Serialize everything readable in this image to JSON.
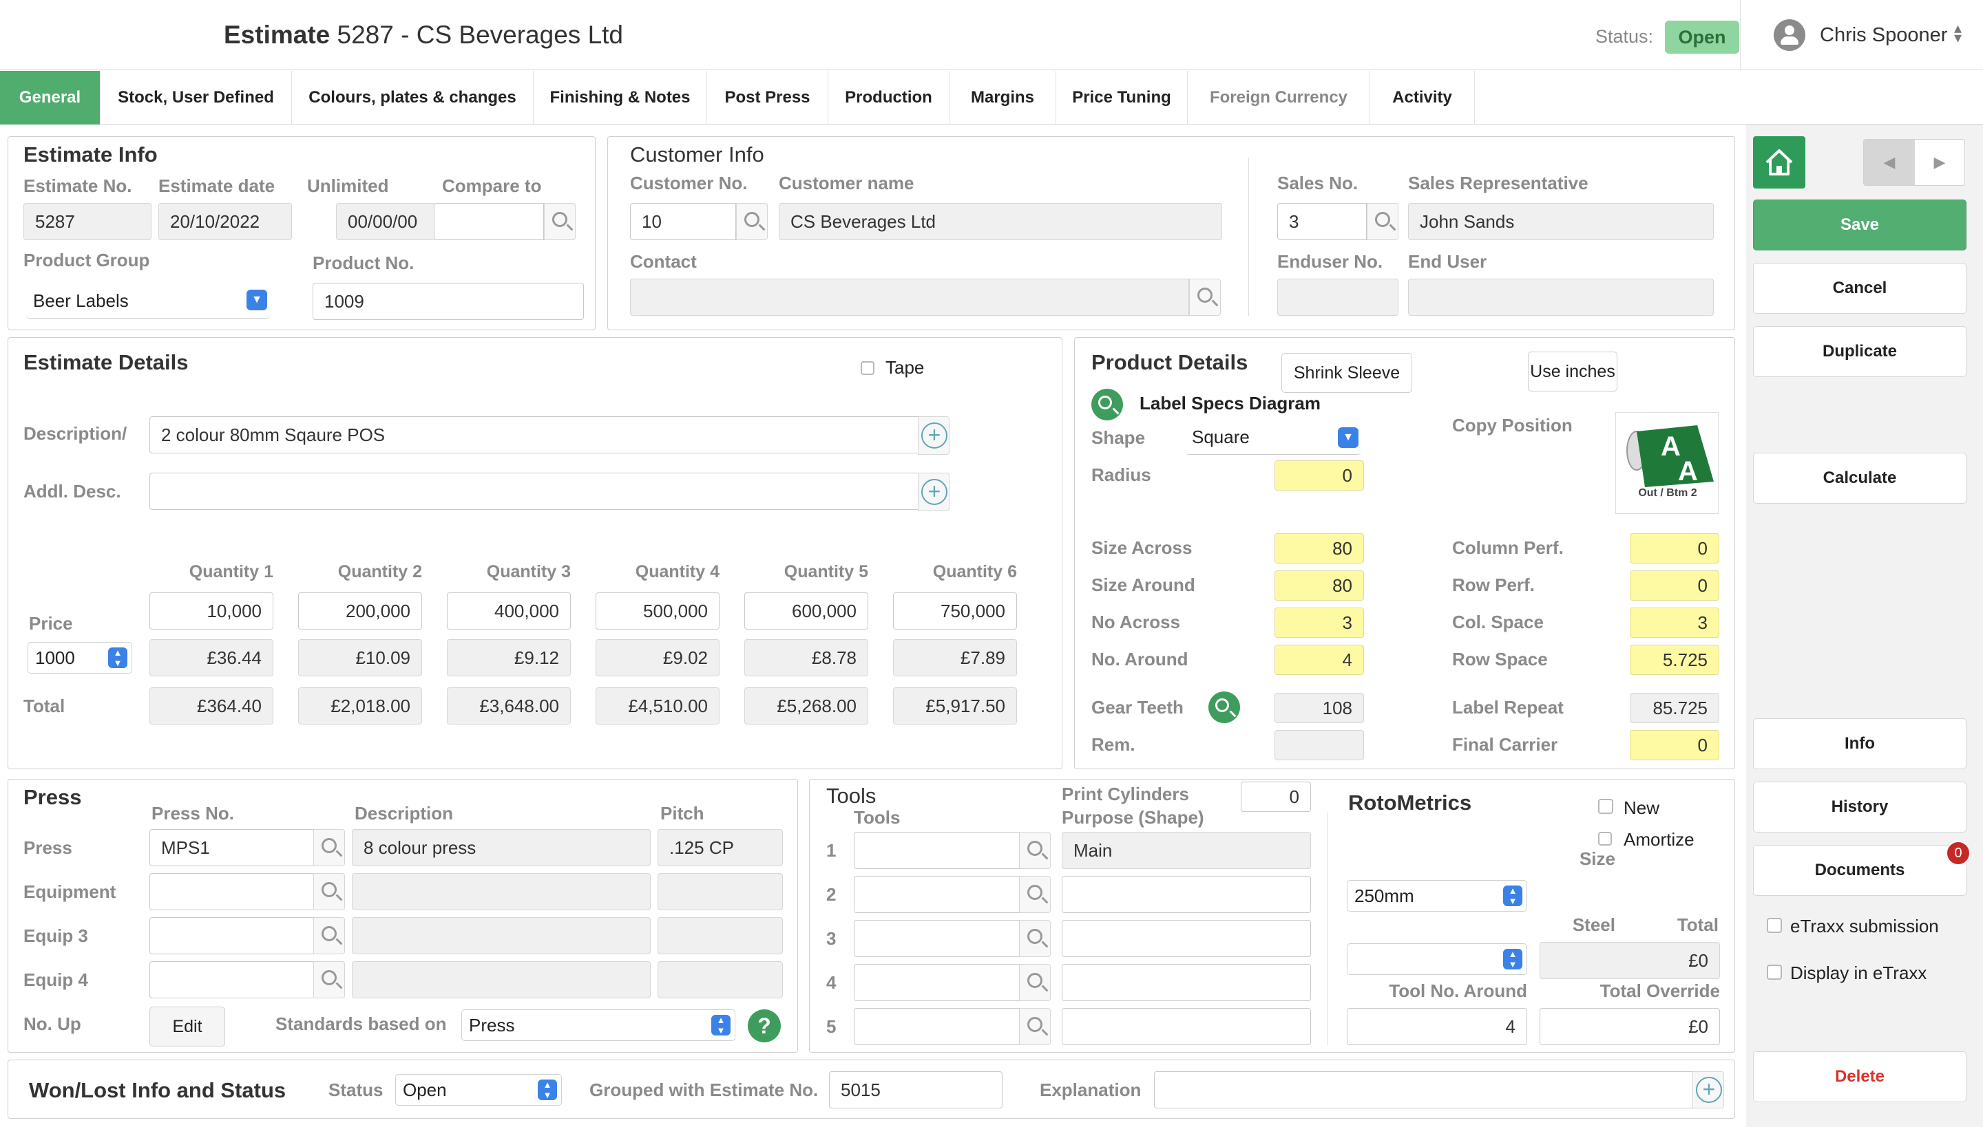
{
  "header": {
    "title_bold": "Estimate",
    "title_number": "5287",
    "title_sep": "-",
    "title_customer": "CS Beverages Ltd",
    "status_label": "Status:",
    "status_value": "Open",
    "user_name": "Chris Spooner"
  },
  "tabs": [
    "General",
    "Stock, User Defined",
    "Colours, plates & changes",
    "Finishing & Notes",
    "Post Press",
    "Production",
    "Margins",
    "Price Tuning",
    "Foreign Currency",
    "Activity"
  ],
  "estimate_info": {
    "heading": "Estimate Info",
    "no_label": "Estimate No.",
    "no": "5287",
    "date_label": "Estimate date",
    "date": "20/10/2022",
    "unlimited_label": "Unlimited",
    "unlimited": "00/00/00",
    "compare_label": "Compare to",
    "compare": "",
    "product_group_label": "Product Group",
    "product_group": "Beer Labels",
    "product_no_label": "Product No.",
    "product_no": "1009"
  },
  "customer_info": {
    "heading": "Customer Info",
    "cust_no_label": "Customer No.",
    "cust_no": "10",
    "cust_name_label": "Customer name",
    "cust_name": "CS Beverages Ltd",
    "contact_label": "Contact",
    "contact": "",
    "sales_no_label": "Sales No.",
    "sales_no": "3",
    "sales_rep_label": "Sales Representative",
    "sales_rep": "John Sands",
    "enduser_no_label": "Enduser No.",
    "enduser_no": "",
    "end_user_label": "End User",
    "end_user": ""
  },
  "estimate_details": {
    "heading": "Estimate Details",
    "tape_label": "Tape",
    "desc_label": "Description/",
    "desc": "2 colour 80mm Sqaure POS",
    "addl_label": "Addl. Desc.",
    "addl": "",
    "quantity_headers": [
      "Quantity 1",
      "Quantity 2",
      "Quantity 3",
      "Quantity 4",
      "Quantity 5",
      "Quantity 6"
    ],
    "quantities": [
      "10,000",
      "200,000",
      "400,000",
      "500,000",
      "600,000",
      "750,000"
    ],
    "price_label": "Price",
    "price_per": "1000",
    "prices": [
      "£36.44",
      "£10.09",
      "£9.12",
      "£9.02",
      "£8.78",
      "£7.89"
    ],
    "total_label": "Total",
    "totals": [
      "£364.40",
      "£2,018.00",
      "£3,648.00",
      "£4,510.00",
      "£5,268.00",
      "£5,917.50"
    ]
  },
  "product_details": {
    "heading": "Product Details",
    "shrink_sleeve": "Shrink Sleeve",
    "use_inches": "Use inches",
    "label_specs": "Label Specs Diagram",
    "shape_label": "Shape",
    "shape": "Square",
    "radius_label": "Radius",
    "radius": "0",
    "copy_position_label": "Copy Position",
    "copy_position_caption": "Out / Btm 2",
    "size_across_label": "Size Across",
    "size_across": "80",
    "size_around_label": "Size Around",
    "size_around": "80",
    "no_across_label": "No Across",
    "no_across": "3",
    "no_around_label": "No. Around",
    "no_around": "4",
    "gear_teeth_label": "Gear Teeth",
    "gear_teeth": "108",
    "rem_label": "Rem.",
    "rem": "",
    "column_perf_label": "Column Perf.",
    "column_perf": "0",
    "row_perf_label": "Row Perf.",
    "row_perf": "0",
    "col_space_label": "Col. Space",
    "col_space": "3",
    "row_space_label": "Row Space",
    "row_space": "5.725",
    "label_repeat_label": "Label Repeat",
    "label_repeat": "85.725",
    "final_carrier_label": "Final Carrier",
    "final_carrier": "0"
  },
  "press": {
    "heading": "Press",
    "press_no_label": "Press No.",
    "description_label": "Description",
    "pitch_label": "Pitch",
    "rows": [
      {
        "label": "Press",
        "no": "MPS1",
        "desc": "8 colour press",
        "pitch": ".125 CP"
      },
      {
        "label": "Equipment",
        "no": "",
        "desc": "",
        "pitch": ""
      },
      {
        "label": "Equip 3",
        "no": "",
        "desc": "",
        "pitch": ""
      },
      {
        "label": "Equip 4",
        "no": "",
        "desc": "",
        "pitch": ""
      }
    ],
    "no_up_label": "No. Up",
    "edit_label": "Edit",
    "standards_label": "Standards based on",
    "standards": "Press"
  },
  "tools": {
    "heading": "Tools",
    "tools_label": "Tools",
    "print_cyl_label": "Print Cylinders",
    "print_cyl": "0",
    "purpose_label": "Purpose (Shape)",
    "rows": [
      {
        "n": "1",
        "tool": "",
        "purpose": "Main"
      },
      {
        "n": "2",
        "tool": "",
        "purpose": ""
      },
      {
        "n": "3",
        "tool": "",
        "purpose": ""
      },
      {
        "n": "4",
        "tool": "",
        "purpose": ""
      },
      {
        "n": "5",
        "tool": "",
        "purpose": ""
      }
    ]
  },
  "rotometrics": {
    "heading": "RotoMetrics",
    "new_label": "New",
    "amortize_label": "Amortize",
    "size_label": "Size",
    "size": "250mm",
    "steel_label": "Steel",
    "steel": "",
    "total_label": "Total",
    "total": "£0",
    "tool_no_around_label": "Tool No. Around",
    "tool_no_around": "4",
    "total_override_label": "Total Override",
    "total_override": "£0"
  },
  "won_lost": {
    "heading": "Won/Lost Info and Status",
    "status_label": "Status",
    "status": "Open",
    "grouped_label": "Grouped with Estimate No.",
    "grouped": "5015",
    "explanation_label": "Explanation",
    "explanation": ""
  },
  "sidebar": {
    "save": "Save",
    "cancel": "Cancel",
    "duplicate": "Duplicate",
    "calculate": "Calculate",
    "info": "Info",
    "history": "History",
    "documents": "Documents",
    "documents_badge": "0",
    "etraxx_submission": "eTraxx submission",
    "display_etraxx": "Display in eTraxx",
    "delete": "Delete"
  },
  "colors": {
    "accent": "#50ad6e",
    "status": "#8ed5a0",
    "highlight": "#fefaa3",
    "delete": "#d9312b",
    "badge": "#c62828"
  }
}
